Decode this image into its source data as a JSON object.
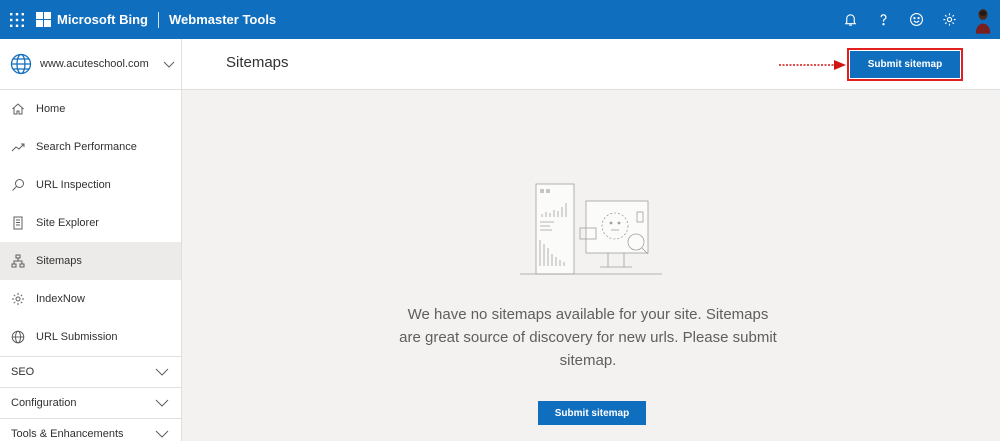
{
  "topbar": {
    "brand": "Microsoft Bing",
    "product": "Webmaster Tools",
    "icons": [
      "notifications-icon",
      "help-icon",
      "feedback-icon",
      "settings-icon"
    ]
  },
  "sidebar": {
    "site": "www.acuteschool.com",
    "items": [
      {
        "label": "Home",
        "icon": "home-icon"
      },
      {
        "label": "Search Performance",
        "icon": "trend-icon"
      },
      {
        "label": "URL Inspection",
        "icon": "search-icon"
      },
      {
        "label": "Site Explorer",
        "icon": "document-icon"
      },
      {
        "label": "Sitemaps",
        "icon": "sitemap-icon",
        "active": true
      },
      {
        "label": "IndexNow",
        "icon": "gear-icon"
      },
      {
        "label": "URL Submission",
        "icon": "globe-icon"
      }
    ],
    "groups": [
      "SEO",
      "Configuration",
      "Tools & Enhancements"
    ]
  },
  "header": {
    "title": "Sitemaps",
    "submit_label": "Submit sitemap"
  },
  "empty_state": {
    "message": "We have no sitemaps available for your site. Sitemaps are great source of discovery for new urls. Please submit sitemap.",
    "button_label": "Submit sitemap"
  },
  "colors": {
    "accent": "#106ebe",
    "highlight": "#e02020"
  }
}
